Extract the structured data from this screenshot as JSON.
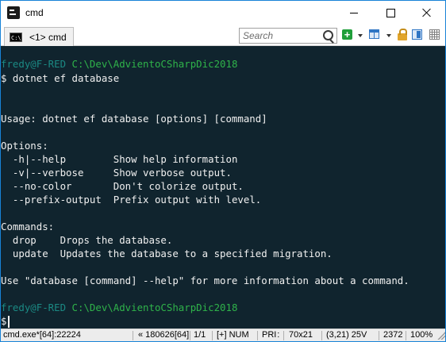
{
  "window": {
    "title": "cmd"
  },
  "tab": {
    "label": "<1> cmd",
    "icon": "console-icon"
  },
  "search": {
    "placeholder": "Search"
  },
  "toolbar_icons": [
    "new-console-icon",
    "dropdown-icon",
    "window-layout-icon",
    "dropdown-icon",
    "lock-icon",
    "panel-icon",
    "grid-icon"
  ],
  "console": {
    "prompt1": {
      "user": "fredy@F-RED",
      "path": "C:\\Dev\\AdvientoCSharpDic2018"
    },
    "command": "$ dotnet ef database",
    "usage": "Usage: dotnet ef database [options] [command]",
    "options_header": "Options:",
    "options": [
      {
        "flag": "  -h|--help        ",
        "desc": "Show help information"
      },
      {
        "flag": "  -v|--verbose     ",
        "desc": "Show verbose output."
      },
      {
        "flag": "  --no-color       ",
        "desc": "Don't colorize output."
      },
      {
        "flag": "  --prefix-output  ",
        "desc": "Prefix output with level."
      }
    ],
    "commands_header": "Commands:",
    "commands": [
      {
        "name": "  drop    ",
        "desc": "Drops the database."
      },
      {
        "name": "  update  ",
        "desc": "Updates the database to a specified migration."
      }
    ],
    "help_hint": "Use \"database [command] --help\" for more information about a command.",
    "prompt2": {
      "user": "fredy@F-RED",
      "path": "C:\\Dev\\AdvientoCSharpDic2018"
    },
    "input_prompt": "$"
  },
  "status": {
    "process": "cmd.exe*[64]:22224",
    "build": "« 180626[64]",
    "pos": "1/1",
    "mods": "[+] NUM",
    "pri": "PRI :",
    "size": "70x21",
    "cursor": "(3,21) 25V",
    "pid": "2372",
    "zoom": "100%"
  },
  "colors": {
    "background": "#10242e",
    "user": "#1b8a84",
    "path": "#2fb34a",
    "text": "#f0f0f0"
  }
}
